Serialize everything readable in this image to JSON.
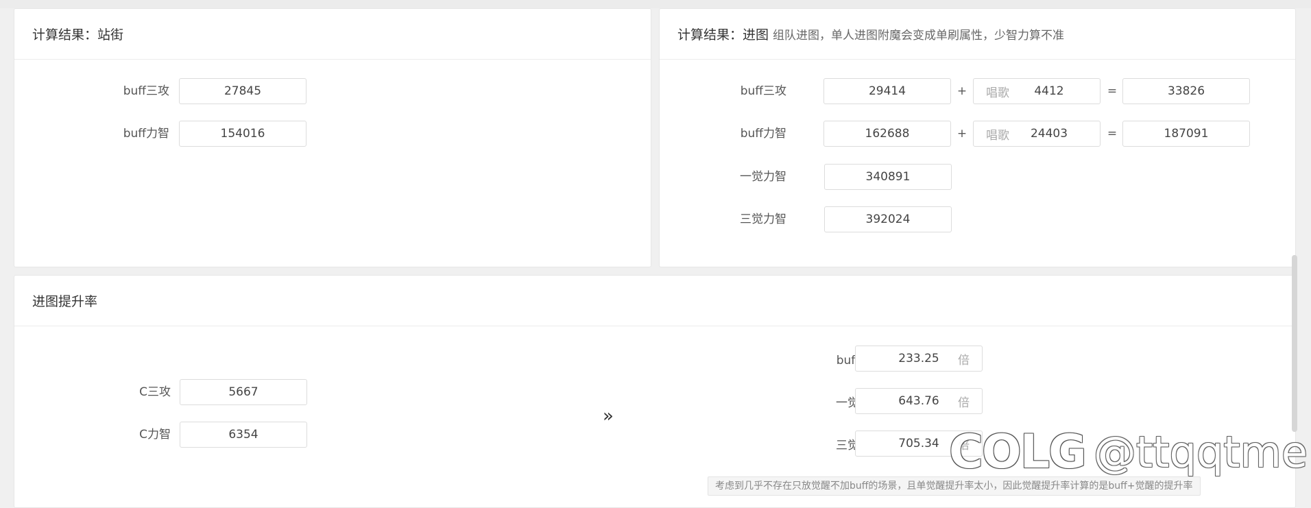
{
  "standing": {
    "title": "计算结果：站街",
    "rows": [
      {
        "label": "buff三攻",
        "value": "27845"
      },
      {
        "label": "buff力智",
        "value": "154016"
      }
    ]
  },
  "dungeon": {
    "title": "计算结果：进图",
    "note": "组队进图，单人进图附魔会变成单刷属性，少智力算不准",
    "rows": [
      {
        "label": "buff三攻",
        "base": "29414",
        "plus": "+",
        "song_label": "唱歌",
        "song": "4412",
        "eq": "=",
        "total": "33826"
      },
      {
        "label": "buff力智",
        "base": "162688",
        "plus": "+",
        "song_label": "唱歌",
        "song": "24403",
        "eq": "=",
        "total": "187091"
      }
    ],
    "awaken1_label": "一觉力智",
    "awaken1_value": "340891",
    "awaken3_label": "三觉力智",
    "awaken3_value": "392024"
  },
  "rate": {
    "title": "进图提升率",
    "inputs": [
      {
        "label": "C三攻",
        "value": "5667"
      },
      {
        "label": "C力智",
        "value": "6354"
      }
    ],
    "arrow": "»",
    "results": [
      {
        "label": "buff",
        "value": "233.25",
        "unit": "倍"
      },
      {
        "label": "一觉",
        "value": "643.76",
        "unit": "倍"
      },
      {
        "label": "三觉",
        "value": "705.34",
        "unit": "倍"
      }
    ],
    "tooltip": "考虑到几乎不存在只放觉醒不加buff的场景，且单觉醒提升率太小，因此觉醒提升率计算的是buff+觉醒的提升率"
  },
  "watermark": {
    "logo": "COLG",
    "handle": "@ttqqtme"
  }
}
